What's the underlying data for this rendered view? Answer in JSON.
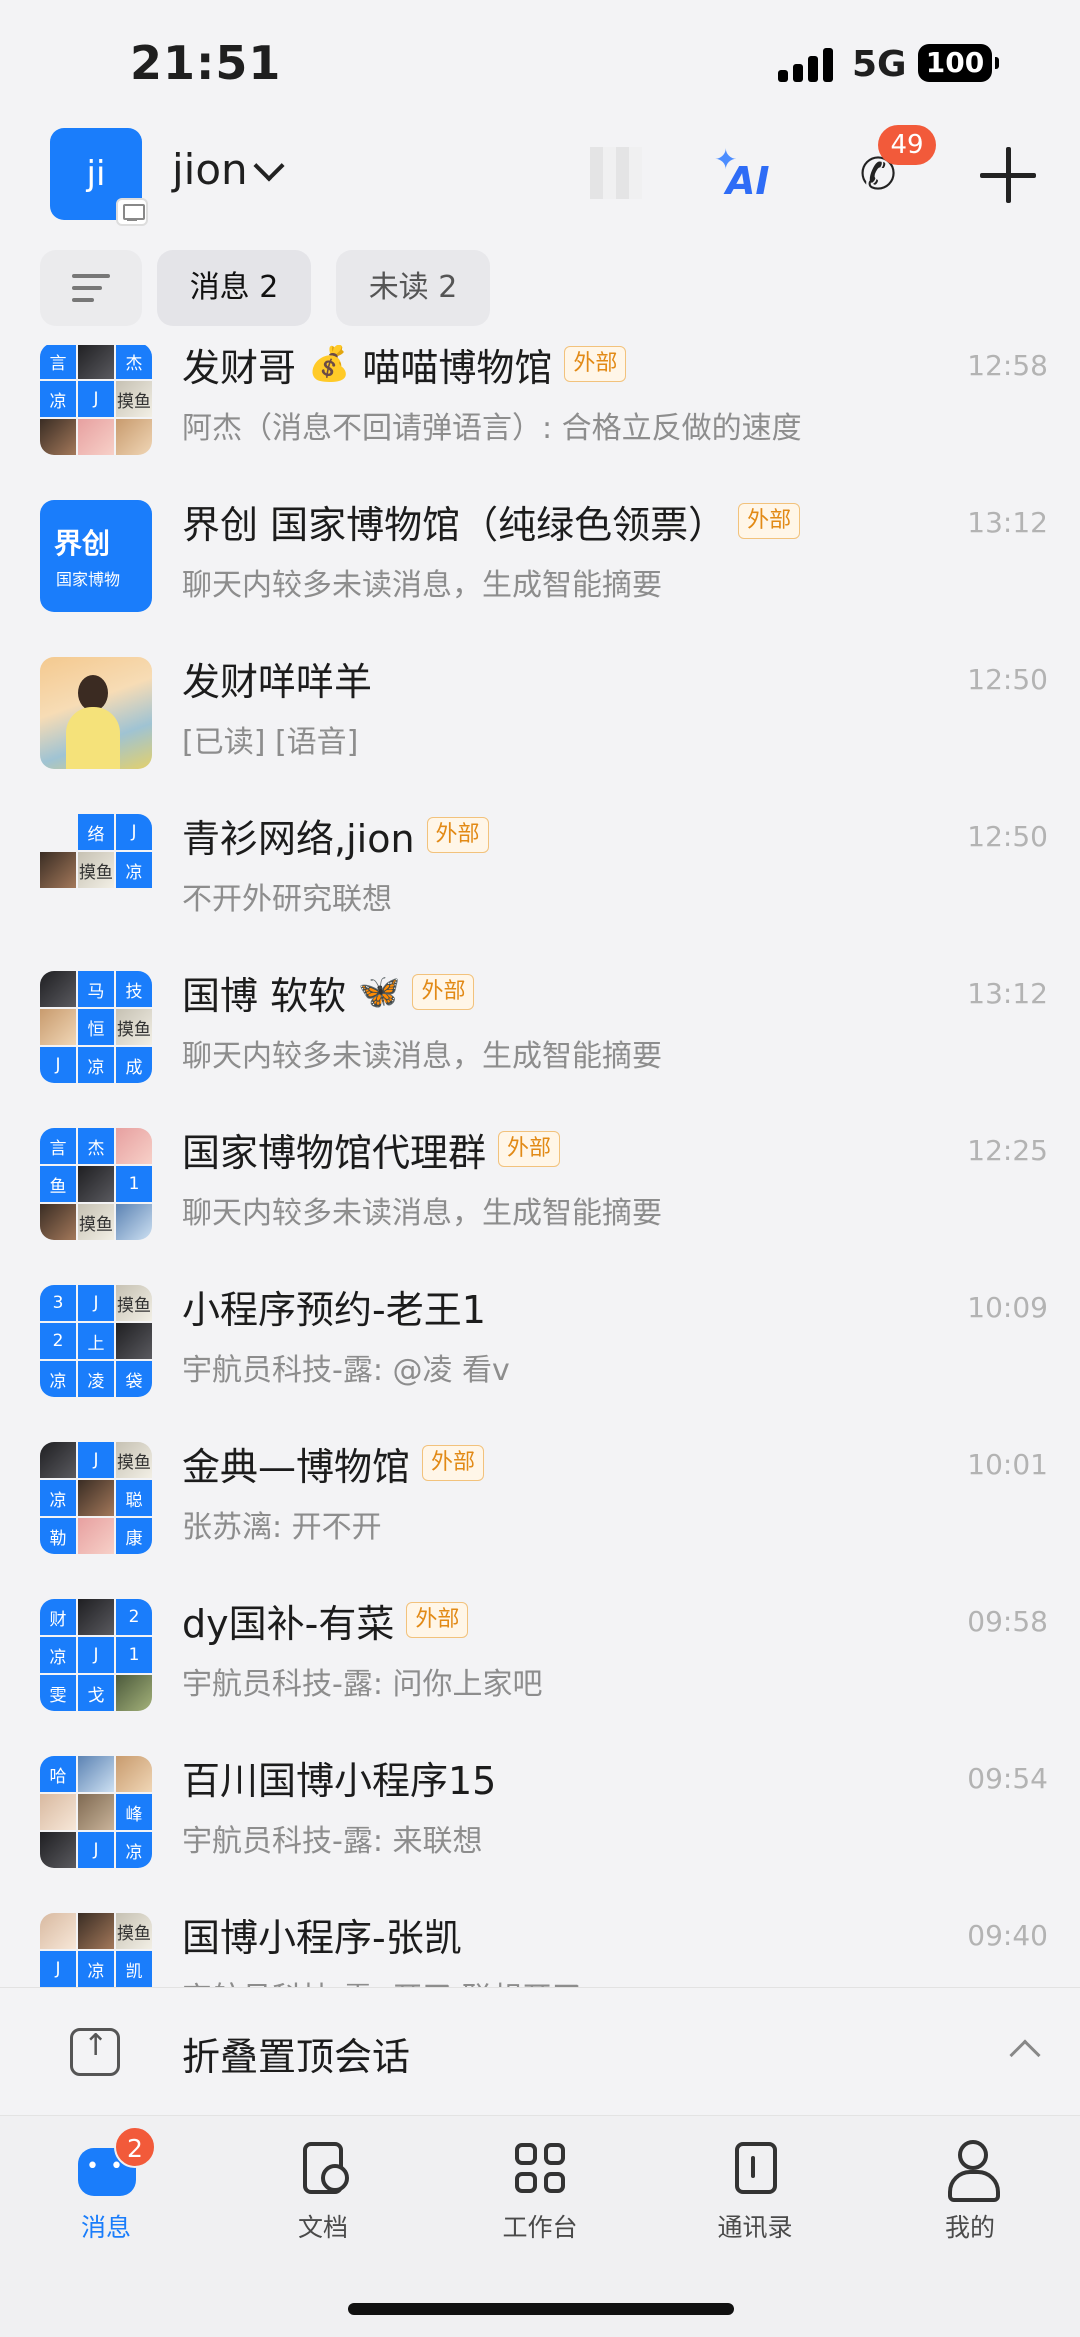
{
  "status_bar": {
    "time": "21:51",
    "network": "5G",
    "battery": "100"
  },
  "header": {
    "avatar_text": "ji",
    "account_name": "jion",
    "call_badge": "49",
    "ai_label": "AI"
  },
  "filters": {
    "messages": "消息 2",
    "unread": "未读 2"
  },
  "chats": [
    {
      "name": "发财哥",
      "emoji": "💰",
      "name2": "喵喵博物馆",
      "external": "外部",
      "time": "12:58",
      "preview": "阿杰（消息不回请弹语言）: 合格立反做的速度"
    },
    {
      "name": "界创 国家博物馆（纯绿色领票）",
      "external": "外部",
      "time": "13:12",
      "preview": "聊天内较多未读消息，生成智能摘要",
      "brand_title": "界创",
      "brand_sub": "国家博物"
    },
    {
      "name": "发财咩咩羊",
      "time": "12:50",
      "preview": "[已读] [语音]"
    },
    {
      "name": "青衫网络,jion",
      "external": "外部",
      "time": "12:50",
      "preview": "不开外研究联想"
    },
    {
      "name": "国博 软软",
      "emoji": "🦋",
      "external": "外部",
      "time": "13:12",
      "preview": "聊天内较多未读消息，生成智能摘要"
    },
    {
      "name": "国家博物馆代理群",
      "external": "外部",
      "time": "12:25",
      "preview": "聊天内较多未读消息，生成智能摘要"
    },
    {
      "name": "小程序预约-老王1",
      "time": "10:09",
      "preview": "宇航员科技-露: @凌 看v"
    },
    {
      "name": "金典—博物馆",
      "external": "外部",
      "time": "10:01",
      "preview": "张苏漓: 开不开"
    },
    {
      "name": "dy国补-有菜",
      "external": "外部",
      "time": "09:58",
      "preview": "宇航员科技-露: 问你上家吧"
    },
    {
      "name": "百川国博小程序15",
      "time": "09:54",
      "preview": "宇航员科技-露: 来联想"
    },
    {
      "name": "国博小程序-张凯",
      "time": "09:40",
      "preview": "宇航员科技-露: 开了 联想开了"
    }
  ],
  "avatar_cells": {
    "a0": [
      "言",
      "",
      "杰",
      "凉",
      "J",
      "",
      "",
      "",
      ""
    ],
    "a3": [
      "络",
      "J",
      "",
      "凉"
    ],
    "a4": [
      "",
      "马",
      "技",
      "",
      "恒",
      "摸鱼",
      "J",
      "凉",
      "成"
    ],
    "a5": [
      "言",
      "杰",
      "",
      "鱼",
      "",
      "1",
      "",
      "摸鱼",
      ""
    ],
    "a6": [
      "3",
      "J",
      "摸鱼",
      "2",
      "上",
      "",
      "凉",
      "凌",
      "袋"
    ],
    "a7": [
      "",
      "J",
      "摸鱼",
      "凉",
      "",
      "聪",
      "勒",
      "",
      "康"
    ],
    "a8": [
      "财",
      "",
      "2",
      "凉",
      "J",
      "1",
      "雯",
      "戈",
      ""
    ],
    "a9": [
      "哈",
      "",
      "",
      "",
      "",
      "峰",
      "",
      "J",
      "凉"
    ],
    "a10": [
      "",
      "",
      "摸鱼",
      "J",
      "凉",
      "凯",
      "",
      "",
      ""
    ]
  },
  "folded_pinned": {
    "label": "折叠置顶会话"
  },
  "tabbar": {
    "items": [
      {
        "label": "消息",
        "badge": "2"
      },
      {
        "label": "文档"
      },
      {
        "label": "工作台"
      },
      {
        "label": "通讯录"
      },
      {
        "label": "我的"
      }
    ]
  },
  "colors": {
    "accent": "#1a7dfb",
    "badge": "#f25a3a",
    "external_tag": "#e28a16"
  }
}
